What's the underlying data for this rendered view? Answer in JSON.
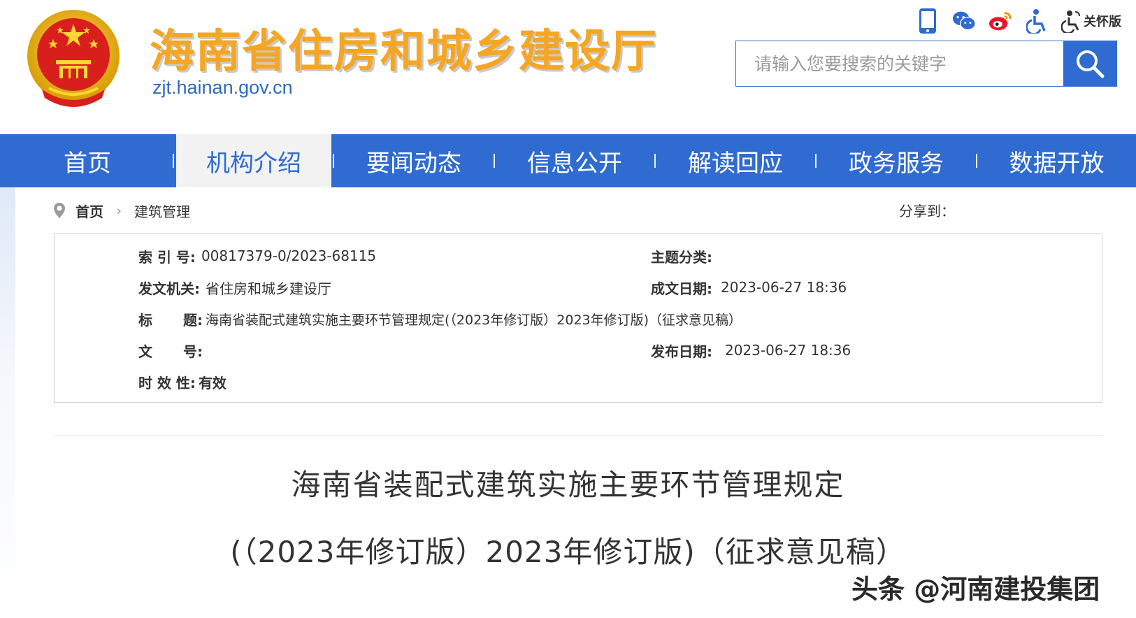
{
  "header": {
    "site_title": "海南省住房和城乡建设厅",
    "site_domain": "zjt.hainan.gov.cn",
    "tools": [
      {
        "icon": "mobile-icon"
      },
      {
        "icon": "wechat-icon"
      },
      {
        "icon": "weibo-icon"
      },
      {
        "icon": "accessibility-icon"
      },
      {
        "icon": "elder-care-icon",
        "label": "关怀版"
      }
    ],
    "search": {
      "placeholder": "请输入您要搜索的关键字",
      "value": ""
    }
  },
  "nav": {
    "items": [
      {
        "label": "首页",
        "active": false
      },
      {
        "label": "机构介绍",
        "active": true
      },
      {
        "label": "要闻动态",
        "active": false
      },
      {
        "label": "信息公开",
        "active": false
      },
      {
        "label": "解读回应",
        "active": false
      },
      {
        "label": "政务服务",
        "active": false
      },
      {
        "label": "数据开放",
        "active": false
      }
    ]
  },
  "breadcrumb": {
    "home": "首页",
    "current": "建筑管理",
    "share_label": "分享到："
  },
  "info": {
    "index_label": "索 引 号:",
    "index_value": "00817379-0/2023-68115",
    "topic_label": "主题分类:",
    "topic_value": "",
    "issuer_label": "发文机关:",
    "issuer_value": "省住房和城乡建设厅",
    "created_label": "成文日期:",
    "created_value": "2023-06-27 18:36",
    "title_label_a": "标",
    "title_label_b": "题:",
    "title_value": "海南省装配式建筑实施主要环节管理规定(（2023年修订版）2023年修订版)（征求意见稿）",
    "docno_label_a": "文",
    "docno_label_b": "号:",
    "docno_value": "",
    "published_label": "发布日期:",
    "published_value": "2023-06-27 18:36",
    "validity_label": "时 效 性:",
    "validity_value": "有效"
  },
  "document": {
    "title_line1": "海南省装配式建筑实施主要环节管理规定",
    "title_line2": "(（2023年修订版）2023年修订版)（征求意见稿）"
  },
  "watermark": "头条 @河南建投集团",
  "colors": {
    "nav_blue": "#2f6bd1",
    "title_orange": "#f5a623",
    "domain_blue": "#2f6bbd"
  }
}
